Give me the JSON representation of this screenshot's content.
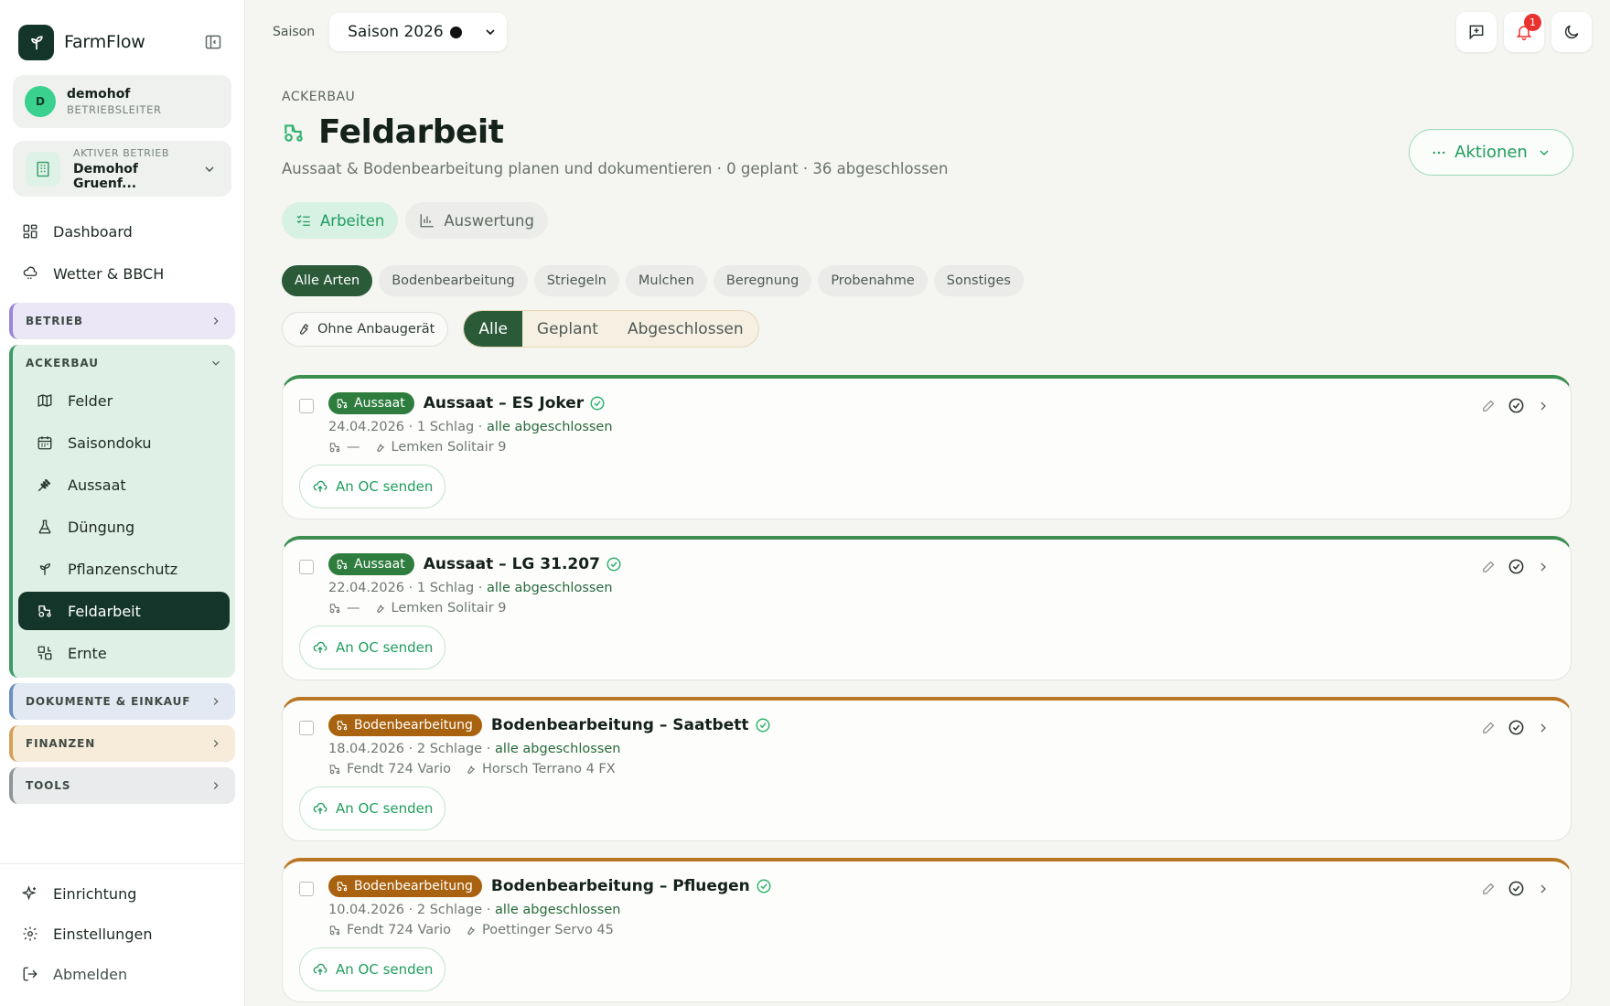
{
  "app": {
    "name": "FarmFlow"
  },
  "user": {
    "initial": "D",
    "name": "demohof",
    "role": "BETRIEBSLEITER"
  },
  "farm": {
    "label": "AKTIVER BETRIEB",
    "name": "Demohof Gruenf..."
  },
  "nav": {
    "dashboard": "Dashboard",
    "weather": "Wetter & BBCH",
    "sections": {
      "betrieb": "BETRIEB",
      "ackerbau": "ACKERBAU",
      "docs": "DOKUMENTE & EINKAUF",
      "finanzen": "FINANZEN",
      "tools": "TOOLS"
    },
    "ackerbau_items": [
      "Felder",
      "Saisondoku",
      "Aussaat",
      "Düngung",
      "Pflanzenschutz",
      "Feldarbeit",
      "Ernte"
    ],
    "bottom": [
      "Einrichtung",
      "Einstellungen",
      "Abmelden"
    ]
  },
  "topbar": {
    "season_label": "Saison",
    "season_value": "Saison 2026",
    "notification_count": "1"
  },
  "page": {
    "crumb": "ACKERBAU",
    "title": "Feldarbeit",
    "subtitle": "Aussaat & Bodenbearbeitung planen und dokumentieren · 0 geplant · 36 abgeschlossen",
    "actions_label": "Aktionen"
  },
  "view_tabs": [
    "Arbeiten",
    "Auswertung"
  ],
  "type_chips": [
    "Alle Arten",
    "Bodenbearbeitung",
    "Striegeln",
    "Mulchen",
    "Beregnung",
    "Probenahme",
    "Sonstiges"
  ],
  "filters": {
    "no_tool": "Ohne Anbaugerät",
    "status": [
      "Alle",
      "Geplant",
      "Abgeschlossen"
    ]
  },
  "send_label": "An OC senden",
  "tasks": [
    {
      "tag": "Aussaat",
      "title": "Aussaat – ES Joker",
      "date": "24.04.2026",
      "fields": "1 Schlag",
      "status": "alle abgeschlossen",
      "tractor": "—",
      "tool": "Lemken Solitair 9",
      "color": "#3c8f4f"
    },
    {
      "tag": "Aussaat",
      "title": "Aussaat – LG 31.207",
      "date": "22.04.2026",
      "fields": "1 Schlag",
      "status": "alle abgeschlossen",
      "tractor": "—",
      "tool": "Lemken Solitair 9",
      "color": "#3c8f4f"
    },
    {
      "tag": "Bodenbearbeitung",
      "title": "Bodenbearbeitung – Saatbett",
      "date": "18.04.2026",
      "fields": "2 Schlage",
      "status": "alle abgeschlossen",
      "tractor": "Fendt 724 Vario",
      "tool": "Horsch Terrano 4 FX",
      "color": "#b97725"
    },
    {
      "tag": "Bodenbearbeitung",
      "title": "Bodenbearbeitung – Pfluegen",
      "date": "10.04.2026",
      "fields": "2 Schlage",
      "status": "alle abgeschlossen",
      "tractor": "Fendt 724 Vario",
      "tool": "Poettinger Servo 45",
      "color": "#b97725"
    }
  ]
}
